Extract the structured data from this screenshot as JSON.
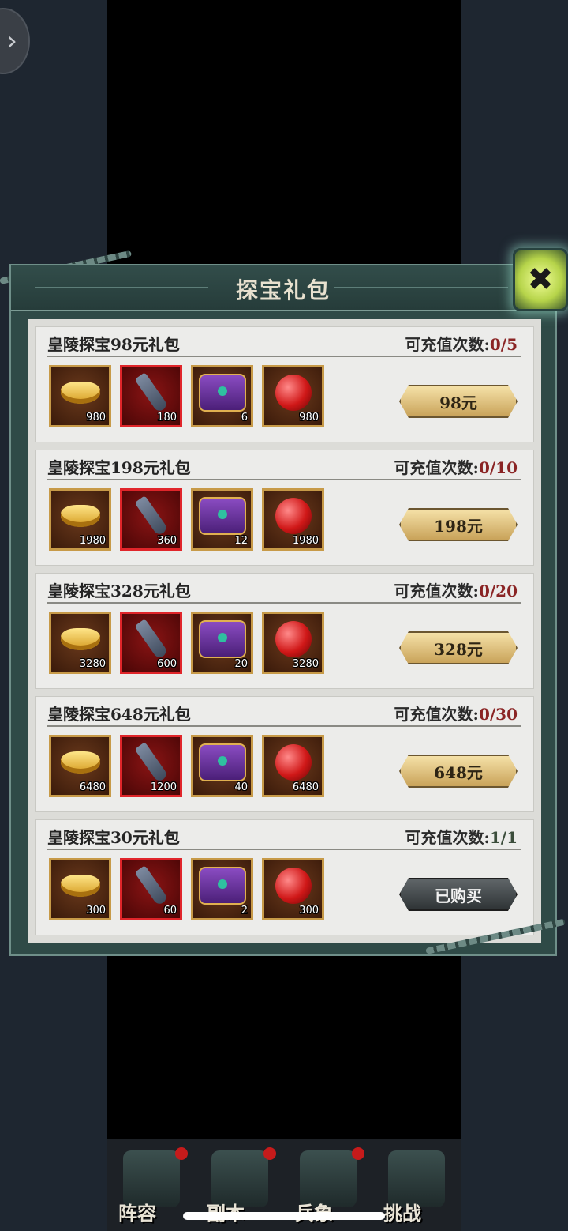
{
  "nav_back": {
    "icon": "chevron-right-icon"
  },
  "panel": {
    "title": "探宝礼包",
    "close_icon": "close-x-icon"
  },
  "packs": [
    {
      "name": "皇陵探宝98元礼包",
      "limit_label": "可充值次数:",
      "limit_value": "0/5",
      "items": [
        {
          "icon": "gold-ingot-icon",
          "qty": "980"
        },
        {
          "icon": "shovel-icon",
          "qty": "180"
        },
        {
          "icon": "treasure-chest-icon",
          "qty": "6"
        },
        {
          "icon": "red-orb-icon",
          "qty": "980"
        }
      ],
      "button": "98元",
      "purchased": false
    },
    {
      "name": "皇陵探宝198元礼包",
      "limit_label": "可充值次数:",
      "limit_value": "0/10",
      "items": [
        {
          "icon": "gold-ingot-icon",
          "qty": "1980"
        },
        {
          "icon": "shovel-icon",
          "qty": "360"
        },
        {
          "icon": "treasure-chest-icon",
          "qty": "12"
        },
        {
          "icon": "red-orb-icon",
          "qty": "1980"
        }
      ],
      "button": "198元",
      "purchased": false
    },
    {
      "name": "皇陵探宝328元礼包",
      "limit_label": "可充值次数:",
      "limit_value": "0/20",
      "items": [
        {
          "icon": "gold-ingot-icon",
          "qty": "3280"
        },
        {
          "icon": "shovel-icon",
          "qty": "600"
        },
        {
          "icon": "treasure-chest-icon",
          "qty": "20"
        },
        {
          "icon": "red-orb-icon",
          "qty": "3280"
        }
      ],
      "button": "328元",
      "purchased": false
    },
    {
      "name": "皇陵探宝648元礼包",
      "limit_label": "可充值次数:",
      "limit_value": "0/30",
      "items": [
        {
          "icon": "gold-ingot-icon",
          "qty": "6480"
        },
        {
          "icon": "shovel-icon",
          "qty": "1200"
        },
        {
          "icon": "treasure-chest-icon",
          "qty": "40"
        },
        {
          "icon": "red-orb-icon",
          "qty": "6480"
        }
      ],
      "button": "648元",
      "purchased": false
    },
    {
      "name": "皇陵探宝30元礼包",
      "limit_label": "可充值次数:",
      "limit_value": "1/1",
      "items": [
        {
          "icon": "gold-ingot-icon",
          "qty": "300"
        },
        {
          "icon": "shovel-icon",
          "qty": "60"
        },
        {
          "icon": "treasure-chest-icon",
          "qty": "2"
        },
        {
          "icon": "red-orb-icon",
          "qty": "300"
        }
      ],
      "button": "已购买",
      "purchased": true
    }
  ],
  "bottom_nav": [
    {
      "label": "阵容",
      "badge": true
    },
    {
      "label": "副本",
      "badge": true
    },
    {
      "label": "兵象",
      "badge": true
    },
    {
      "label": "挑战",
      "badge": false
    }
  ],
  "colors": {
    "limit_red": "#8a2424",
    "button_gold": "#c9a35a",
    "button_done": "#2f3436",
    "item_border_gold": "#c79a48",
    "item_border_red": "#e0252a"
  }
}
